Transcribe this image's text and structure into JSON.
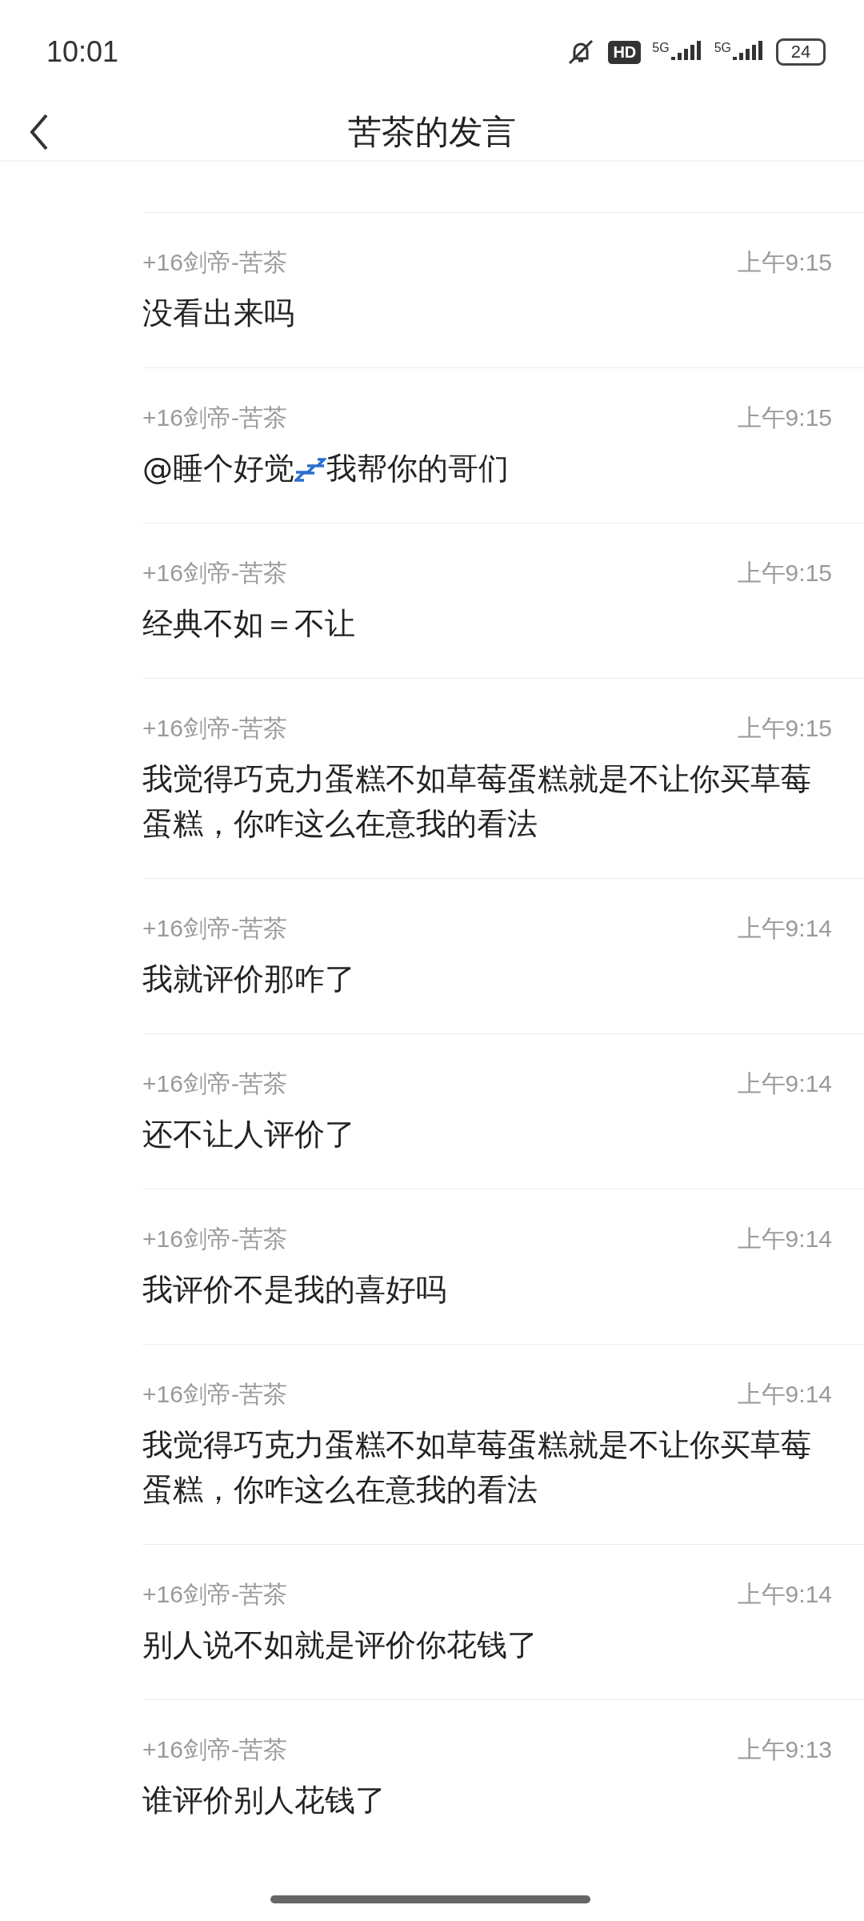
{
  "status_bar": {
    "time": "10:01",
    "hd": "HD",
    "networks": [
      "5G",
      "5G"
    ],
    "battery": "24"
  },
  "header": {
    "title": "苦茶的发言"
  },
  "messages": [
    {
      "sender": "+16剑帝-苦茶",
      "time": "上午9:15",
      "text": "没看出来吗"
    },
    {
      "sender": "+16剑帝-苦茶",
      "time": "上午9:15",
      "mention": "@睡个好觉",
      "text": " 我帮你的哥们"
    },
    {
      "sender": "+16剑帝-苦茶",
      "time": "上午9:15",
      "text": "经典不如＝不让"
    },
    {
      "sender": "+16剑帝-苦茶",
      "time": "上午9:15",
      "text": "我觉得巧克力蛋糕不如草莓蛋糕就是不让你买草莓蛋糕，你咋这么在意我的看法"
    },
    {
      "sender": "+16剑帝-苦茶",
      "time": "上午9:14",
      "text": "我就评价那咋了"
    },
    {
      "sender": "+16剑帝-苦茶",
      "time": "上午9:14",
      "text": "还不让人评价了"
    },
    {
      "sender": "+16剑帝-苦茶",
      "time": "上午9:14",
      "text": "我评价不是我的喜好吗"
    },
    {
      "sender": "+16剑帝-苦茶",
      "time": "上午9:14",
      "text": "我觉得巧克力蛋糕不如草莓蛋糕就是不让你买草莓蛋糕，你咋这么在意我的看法"
    },
    {
      "sender": "+16剑帝-苦茶",
      "time": "上午9:14",
      "text": "别人说不如就是评价你花钱了"
    },
    {
      "sender": "+16剑帝-苦茶",
      "time": "上午9:13",
      "text": "谁评价别人花钱了"
    }
  ]
}
